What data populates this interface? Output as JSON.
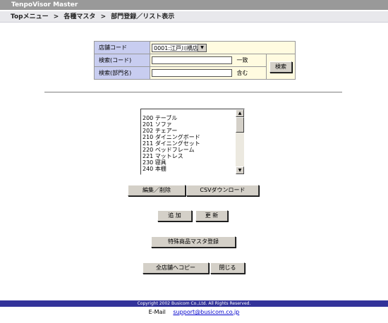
{
  "app_title": "TenpoVisor Master",
  "breadcrumb": [
    "Topメニュー",
    "各種マスタ",
    "部門登録／リスト表示"
  ],
  "breadcrumb_sep": ">",
  "search": {
    "store_label": "店舗コード",
    "store_value": "0001:江戸川橋店",
    "code_label": "検索(コード)",
    "code_value": "",
    "code_suffix": "一致",
    "name_label": "検索(部門名)",
    "name_value": "",
    "name_suffix": "含む",
    "search_button": "検索"
  },
  "list": {
    "items": [
      "200 テーブル",
      "201 ソファ",
      "202 チェアー",
      "210 ダイニングボード",
      "211 ダイニングセット",
      "220 ベッドフレーム",
      "221 マットレス",
      "230 寝具",
      "240 本棚"
    ]
  },
  "buttons": {
    "edit_delete": "編集／削除",
    "csv_download": "CSVダウンロード",
    "add": "追 加",
    "update": "更 新",
    "special_product": "特殊商品マスタ登録",
    "copy_all_stores": "全店舗へコピー",
    "close": "閉じる"
  },
  "footer": {
    "copyright": "Copyright 2002 Busicom Co.,Ltd. All Rights Reserved.",
    "email_label": "E-Mail",
    "email_address": "support@busicom.co.jp"
  },
  "colors": {
    "title_bar": "#999999",
    "label_cell": "#c8cdf0",
    "field_cell": "#fffbe0",
    "footer_bar": "#33339a"
  }
}
